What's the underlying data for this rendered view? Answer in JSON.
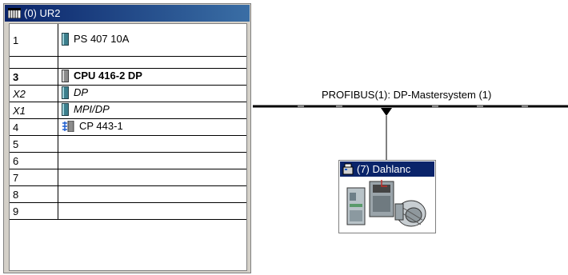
{
  "rack": {
    "title": "(0) UR2",
    "rows": [
      {
        "slot": "1",
        "module": "PS 407 10A"
      },
      {
        "slot": "3",
        "module": "CPU 416-2 DP"
      },
      {
        "slot": "X2",
        "module": "DP"
      },
      {
        "slot": "X1",
        "module": "MPI/DP"
      },
      {
        "slot": "4",
        "module": "CP 443-1"
      },
      {
        "slot": "5",
        "module": ""
      },
      {
        "slot": "6",
        "module": ""
      },
      {
        "slot": "7",
        "module": ""
      },
      {
        "slot": "8",
        "module": ""
      },
      {
        "slot": "9",
        "module": ""
      }
    ]
  },
  "bus": {
    "label": "PROFIBUS(1): DP-Mastersystem (1)"
  },
  "slave": {
    "title": "(7) Dahlanc"
  },
  "icons": {
    "rack_title": "rack-grid-icon",
    "module": "module-icon",
    "network": "network-cp-icon",
    "slave_title": "dp-slave-icon",
    "slave_image": "drive-motor-icon"
  }
}
